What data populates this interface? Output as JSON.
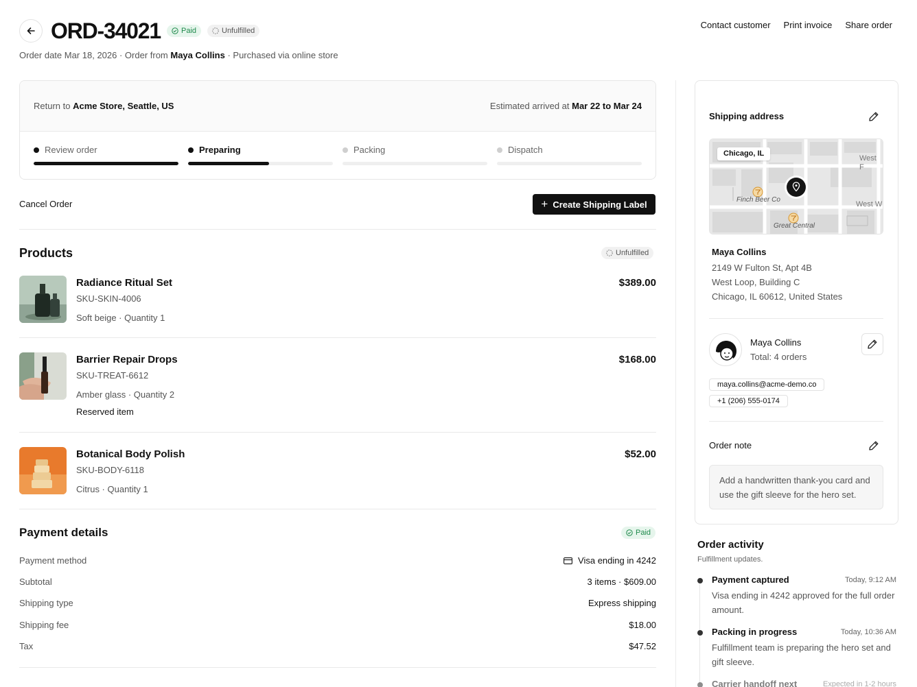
{
  "header": {
    "order_id": "ORD-34021",
    "payment_badge": "Paid",
    "fulfillment_badge": "Unfulfilled",
    "actions": [
      "Contact customer",
      "Print invoice",
      "Share order"
    ],
    "order_date_prefix": "Order date Mar 18, 2026 · Order from ",
    "customer_name": "Maya Collins",
    "purchased_via": " · Purchased via online store"
  },
  "shipping_progress": {
    "return_prefix": "Return to ",
    "return_location": "Acme Store, Seattle, US",
    "eta_prefix": "Estimated arrived at ",
    "eta_range": "Mar 22 to Mar 24",
    "steps": [
      {
        "label": "Review order",
        "state": "done",
        "progress": 1.0
      },
      {
        "label": "Preparing",
        "state": "active",
        "progress": 0.56
      },
      {
        "label": "Packing",
        "state": "pending",
        "progress": 0.0
      },
      {
        "label": "Dispatch",
        "state": "pending",
        "progress": 0.0
      }
    ]
  },
  "actions": {
    "cancel_label": "Cancel Order",
    "create_label": "Create Shipping Label"
  },
  "products": {
    "title": "Products",
    "status_badge": "Unfulfilled",
    "items": [
      {
        "name": "Radiance Ritual Set",
        "sku": "SKU-SKIN-4006",
        "meta": "Soft beige · Quantity 1",
        "extra": "",
        "price": "$389.00"
      },
      {
        "name": "Barrier Repair Drops",
        "sku": "SKU-TREAT-6612",
        "meta": "Amber glass · Quantity 2",
        "extra": "Reserved item",
        "price": "$168.00"
      },
      {
        "name": "Botanical Body Polish",
        "sku": "SKU-BODY-6118",
        "meta": "Citrus · Quantity 1",
        "extra": "",
        "price": "$52.00"
      }
    ]
  },
  "payment": {
    "title": "Payment details",
    "status_badge": "Paid",
    "rows": [
      {
        "label": "Payment method",
        "value": "Visa ending in 4242"
      },
      {
        "label": "Subtotal",
        "value": "3 items · $609.00"
      },
      {
        "label": "Shipping type",
        "value": "Express shipping"
      },
      {
        "label": "Shipping fee",
        "value": "$18.00"
      },
      {
        "label": "Tax",
        "value": "$47.52"
      }
    ]
  },
  "shipping_address": {
    "title": "Shipping address",
    "map_city_label": "Chicago, IL",
    "map_street_1": "West F",
    "map_street_2": "West W",
    "map_poi_1": "Finch Beer Co",
    "map_poi_2": "Great Central",
    "name": "Maya Collins",
    "lines": [
      "2149 W Fulton St, Apt 4B",
      "West Loop, Building C",
      "Chicago, IL 60612, United States"
    ]
  },
  "customer": {
    "name": "Maya Collins",
    "orders": "Total: 4 orders",
    "email": "maya.collins@acme-demo.co",
    "phone": "+1 (206) 555-0174"
  },
  "order_note": {
    "title": "Order note",
    "text": "Add a handwritten thank-you card and use the gift sleeve for the hero set."
  },
  "activity": {
    "title": "Order activity",
    "subtitle": "Fulfillment updates.",
    "items": [
      {
        "title": "Payment captured",
        "time": "Today, 9:12 AM",
        "desc": "Visa ending in 4242 approved for the full order amount."
      },
      {
        "title": "Packing in progress",
        "time": "Today, 10:36 AM",
        "desc": "Fulfillment team is preparing the hero set and gift sleeve."
      },
      {
        "title": "Carrier handoff next",
        "time": "Expected in 1-2 hours",
        "desc": ""
      }
    ]
  }
}
